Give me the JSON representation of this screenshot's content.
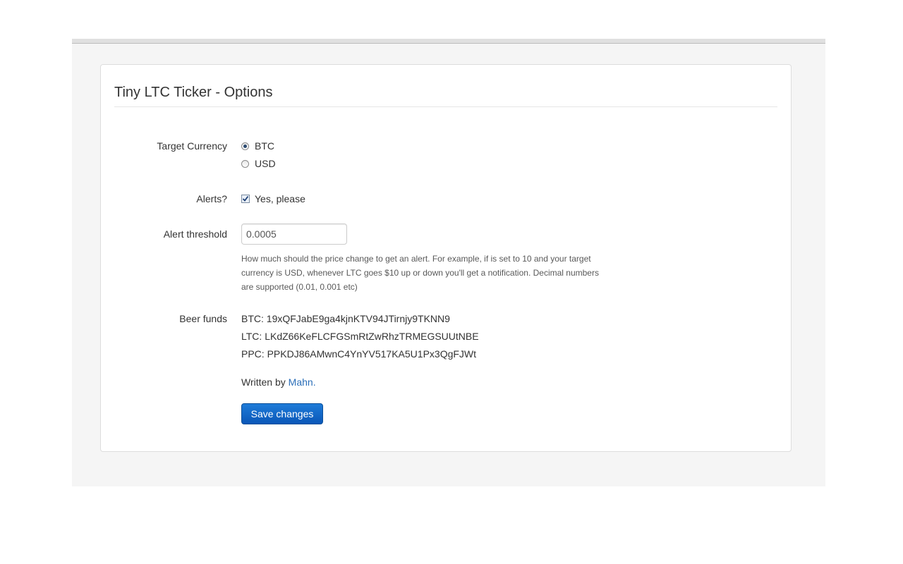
{
  "page": {
    "title": "Tiny LTC Ticker - Options"
  },
  "form": {
    "target_currency": {
      "label": "Target Currency",
      "options": [
        {
          "label": "BTC",
          "checked": true
        },
        {
          "label": "USD",
          "checked": false
        }
      ]
    },
    "alerts": {
      "label": "Alerts?",
      "checkbox_label": "Yes, please",
      "checked": true
    },
    "alert_threshold": {
      "label": "Alert threshold",
      "value": "0.0005",
      "help": "How much should the price change to get an alert. For example, if is set to 10 and your target currency is USD, whenever LTC goes $10 up or down you'll get a notification. Decimal numbers are supported (0.01, 0.001 etc)"
    },
    "beer_funds": {
      "label": "Beer funds",
      "addresses": [
        "BTC: 19xQFJabE9ga4kjnKTV94JTirnjy9TKNN9",
        "LTC: LKdZ66KeFLCFGSmRtZwRhzTRMEGSUUtNBE",
        "PPC: PPKDJ86AMwnC4YnYV517KA5U1Px3QgFJWt"
      ]
    },
    "credit": {
      "prefix": "Written by ",
      "author": "Mahn",
      "suffix": "."
    },
    "save_label": "Save changes"
  },
  "colors": {
    "accent": "#0a57b8",
    "link": "#2a6eb8",
    "page_background": "#f5f5f5"
  }
}
